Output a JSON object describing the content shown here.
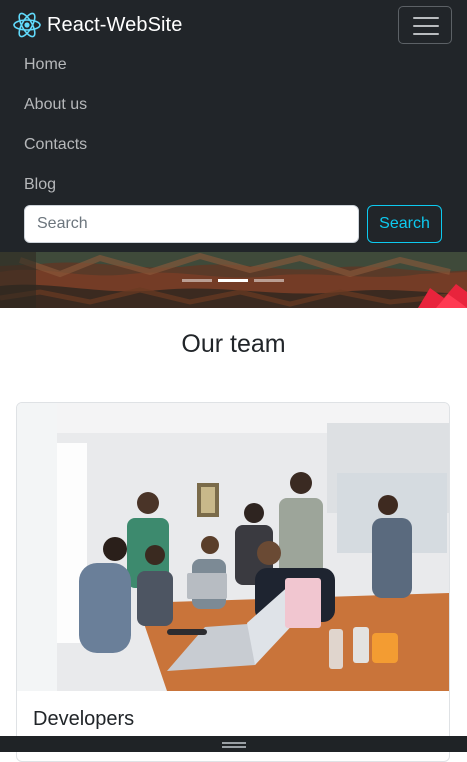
{
  "navbar": {
    "brand_logo": "react-atom-logo",
    "brand_text": "React-WebSite",
    "toggler_icon": "hamburger-menu-icon",
    "links": [
      "Home",
      "About us",
      "Contacts",
      "Blog"
    ],
    "search": {
      "placeholder": "Search",
      "value": "",
      "button_label": "Search"
    },
    "background": "#212529",
    "accent": "#0dcaf0"
  },
  "carousel": {
    "slide_count": 3,
    "active_slide": 2
  },
  "team": {
    "title": "Our team",
    "cards": [
      {
        "title": "Developers",
        "image_icon": "team-meeting-photo"
      }
    ]
  }
}
